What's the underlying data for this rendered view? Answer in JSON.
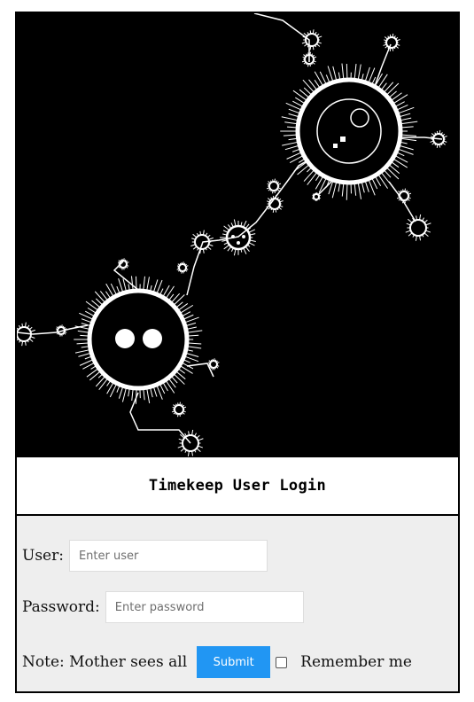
{
  "header": {
    "title": "Timekeep User Login"
  },
  "form": {
    "user": {
      "label": "User:",
      "placeholder": "Enter user",
      "value": ""
    },
    "password": {
      "label": "Password:",
      "placeholder": "Enter password",
      "value": ""
    },
    "note": "Note: Mother sees all",
    "submit_label": "Submit",
    "remember_label": "Remember me",
    "remember_checked": false
  },
  "colors": {
    "accent": "#2196f3",
    "form_background": "#eeeeee",
    "banner_background": "#000000"
  },
  "image": {
    "subject": "fractal-banner"
  }
}
